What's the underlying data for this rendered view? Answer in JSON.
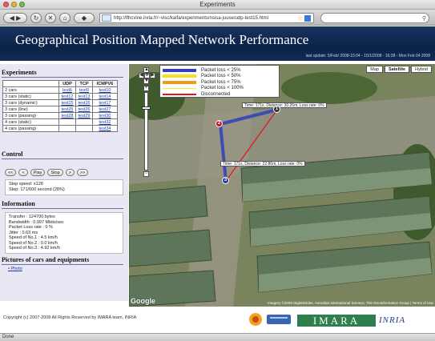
{
  "window": {
    "title": "Experiments"
  },
  "browser": {
    "url": "http://lfhcvine.inria.fr/~visc/kaifa/experiments/nsisa-juuse/udp-test15.html",
    "back_icon": "back-arrow-icon",
    "forward_icon": "forward-arrow-icon",
    "reload_icon": "reload-icon",
    "stop_icon": "stop-icon",
    "home_icon": "home-icon",
    "status_text": "Done"
  },
  "header": {
    "title": "Geographical Position Mapped Network Performance",
    "last_update": "last update: 5/Feb/ 2008-15:04 - 15/1/2008 - 16:38 - Mon Feb 04 2008"
  },
  "experiments": {
    "title": "Experiments",
    "columns": [
      "",
      "UDP",
      "TCP",
      "ICMPV6"
    ],
    "rows": [
      {
        "label": "2 cars",
        "udp": "test6",
        "tcp": "test9",
        "icmp": "test10"
      },
      {
        "label": "3 cars (static)",
        "udp": "test12",
        "tcp": "test13",
        "icmp": "test14"
      },
      {
        "label": "3 cars (dynamic)",
        "udp": "test15",
        "tcp": "test16",
        "icmp": "test17"
      },
      {
        "label": "3 cars (line)",
        "udp": "test25",
        "tcp": "test26",
        "icmp": "test27"
      },
      {
        "label": "3 cars (passing)",
        "udp": "test28",
        "tcp": "test29",
        "icmp": "test30"
      },
      {
        "label": "4 cars (static)",
        "udp": "",
        "tcp": "",
        "icmp": "test32"
      },
      {
        "label": "4 cars (passing)",
        "udp": "",
        "tcp": "",
        "icmp": "test34"
      }
    ]
  },
  "control": {
    "title": "Control",
    "buttons": [
      "<<",
      "<",
      "Play",
      "Stop",
      ">",
      ">>"
    ],
    "step_speed": "Step speed: x128",
    "step": "Step: 171/600 second (28%)"
  },
  "information": {
    "title": "Information",
    "lines": [
      "Transfer : 124700 bytes",
      "Bandwidth : 0.997 Mbits/sec",
      "Packet Loss rate : 0 %",
      "Jitter : 0.63 ms",
      "Speed of No.1 : 4.5 km/h",
      "Speed of No.2 : 0.0 km/h",
      "Speed of No.3 : 4.92 km/h"
    ]
  },
  "pictures": {
    "title": "Pictures of cars and equipments",
    "link": "Photo"
  },
  "map": {
    "legend": [
      {
        "label": "Packet loss < 25%",
        "color": "#3140b8"
      },
      {
        "label": "Packet loss < 50%",
        "color": "#f5e31e"
      },
      {
        "label": "Packet loss < 75%",
        "color": "#f39a1c"
      },
      {
        "label": "Packet loss < 100%",
        "color": "#f3f028"
      },
      {
        "label": "Disconnected",
        "color": "#e4131c"
      }
    ],
    "map_types": [
      "Map",
      "Satellite",
      "Hybrid"
    ],
    "callouts": [
      "Time: 171s, Distance: 30.26m, Loss rate: 0%",
      "Time: 171s, Distance: 22.86m, Loss rate: 0%"
    ],
    "markers": [
      "1",
      "2",
      "3"
    ],
    "logo": "Google",
    "copyright": "Imagery ©2008 DigitalGlobe, Aerodata International Surveys, The GeoInformation Group | Terms of Use"
  },
  "footer": {
    "copyright": "Copyright (c) 2007-2008 All Rights Reserved by IMARA team, INRIA",
    "imara": "IMARA",
    "inria": "INRIA"
  },
  "colors": {
    "header_bg": "#0c2348",
    "panel_bg": "#e9e7f3",
    "link": "#1a3ca8"
  }
}
